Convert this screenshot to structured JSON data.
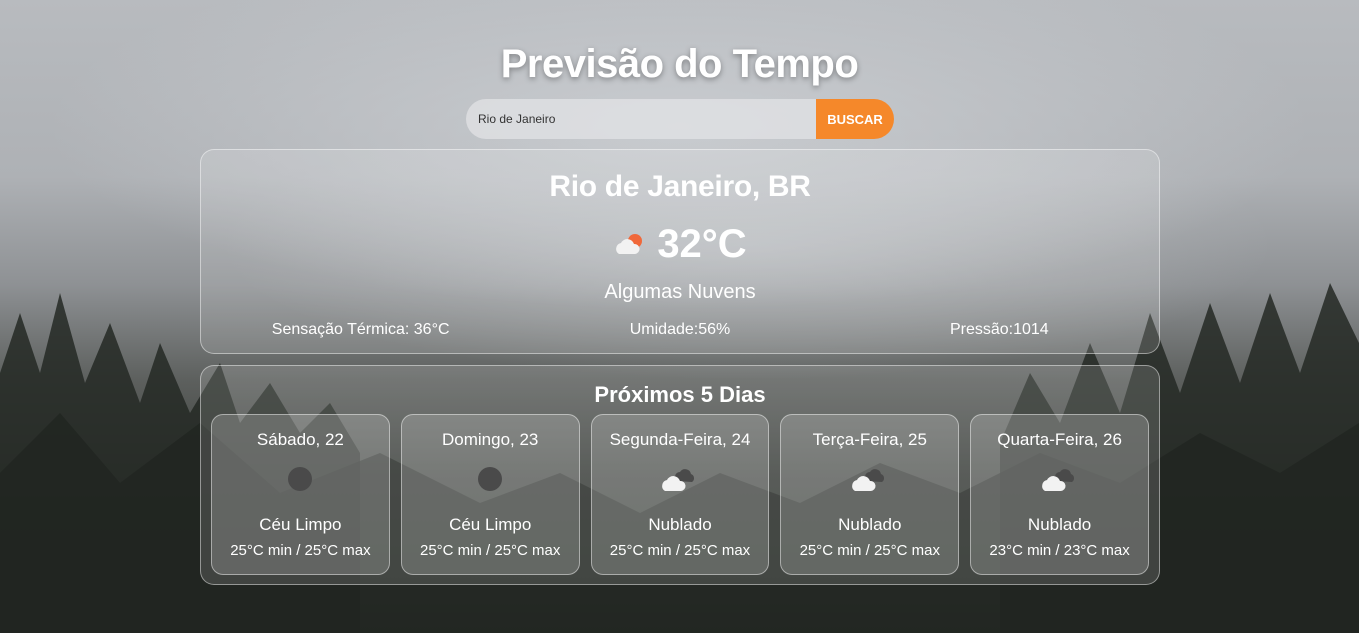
{
  "page": {
    "title": "Previsão do Tempo"
  },
  "search": {
    "value": "Rio de Janeiro",
    "button_label": "BUSCAR",
    "accent": "#f5882a"
  },
  "current": {
    "city": "Rio de Janeiro, BR",
    "icon": "partly-cloudy-sun-icon",
    "temperature": "32°C",
    "description": "Algumas Nuvens",
    "feels_like": "Sensação Térmica: 36°C",
    "humidity": "Umidade:56%",
    "pressure": "Pressão:1014"
  },
  "forecast": {
    "title": "Próximos 5 Dias",
    "days": [
      {
        "name": "Sábado, 22",
        "icon": "clear-night-icon",
        "description": "Céu Limpo",
        "range": "25°C min / 25°C max"
      },
      {
        "name": "Domingo, 23",
        "icon": "clear-night-icon",
        "description": "Céu Limpo",
        "range": "25°C min / 25°C max"
      },
      {
        "name": "Segunda-Feira, 24",
        "icon": "overcast-clouds-icon",
        "description": "Nublado",
        "range": "25°C min / 25°C max"
      },
      {
        "name": "Terça-Feira, 25",
        "icon": "overcast-clouds-icon",
        "description": "Nublado",
        "range": "25°C min / 25°C max"
      },
      {
        "name": "Quarta-Feira, 26",
        "icon": "overcast-clouds-icon",
        "description": "Nublado",
        "range": "23°C min / 23°C max"
      }
    ]
  }
}
